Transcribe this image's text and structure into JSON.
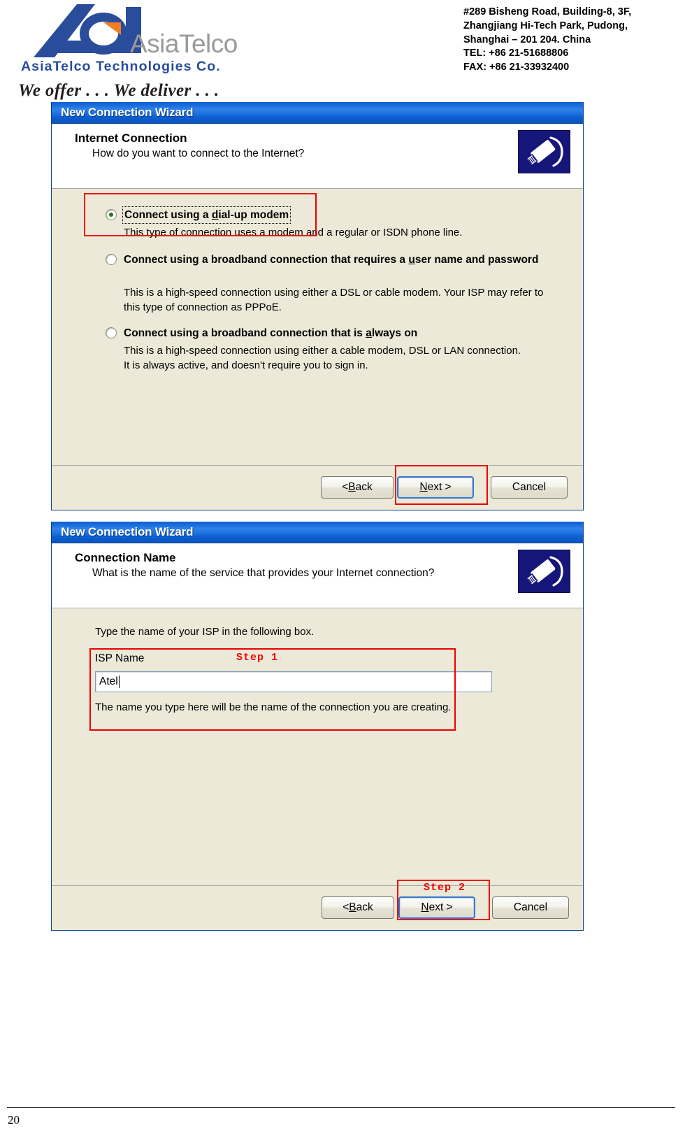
{
  "letterhead": {
    "logo_wordmark": "AsiaTelco",
    "logo_company": "AsiaTelco Technologies Co.",
    "logo_tagline": "We offer . . . We deliver . . .",
    "address_lines": [
      "#289 Bisheng Road, Building-8, 3F,",
      "Zhangjiang Hi-Tech Park, Pudong,",
      "Shanghai – 201 204. China",
      "TEL: +86 21-51688806",
      "FAX: +86 21-33932400"
    ]
  },
  "dialog1": {
    "title": "New Connection Wizard",
    "header_title": "Internet Connection",
    "header_subtitle": "How do you want to connect to the Internet?",
    "icon": "modem-plug-icon",
    "options": [
      {
        "label_pre": "Connect using a ",
        "label_accel": "d",
        "label_post": "ial-up modem",
        "description": "This type of connection uses a modem and a regular or ISDN phone line.",
        "selected": true,
        "focused": true
      },
      {
        "label_pre": "Connect using a broadband connection that requires a ",
        "label_accel": "u",
        "label_post": "ser name and password",
        "description": "This is a high-speed connection using either a DSL or cable modem. Your ISP may refer to this type of connection as PPPoE.",
        "selected": false,
        "focused": false
      },
      {
        "label_pre": "Connect using a broadband connection that is ",
        "label_accel": "a",
        "label_post": "lways on",
        "description": "This is a high-speed connection using either a cable modem, DSL or LAN connection. It is always active, and doesn't require you to sign in.",
        "selected": false,
        "focused": false
      }
    ],
    "buttons": {
      "back_pre": "< ",
      "back_accel": "B",
      "back_post": "ack",
      "next_accel": "N",
      "next_post": "ext >",
      "cancel": "Cancel"
    }
  },
  "dialog2": {
    "title": "New Connection Wizard",
    "header_title": "Connection Name",
    "header_subtitle": "What is the name of the service that provides your Internet connection?",
    "icon": "modem-plug-icon",
    "instruction": "Type the name of your ISP in the following box.",
    "isp_label_pre": "ISP N",
    "isp_label_accel": "a",
    "isp_label_post": "me",
    "isp_value": "Atel",
    "isp_placeholder": "",
    "hint": "The name you type here will be the name of the connection you are creating.",
    "buttons": {
      "back_pre": "< ",
      "back_accel": "B",
      "back_post": "ack",
      "next_accel": "N",
      "next_post": "ext >",
      "cancel": "Cancel"
    }
  },
  "annotations": {
    "step1": "Step 1",
    "step2": "Step 2",
    "color": "#ee0000"
  },
  "footer": {
    "page_number": "20"
  }
}
